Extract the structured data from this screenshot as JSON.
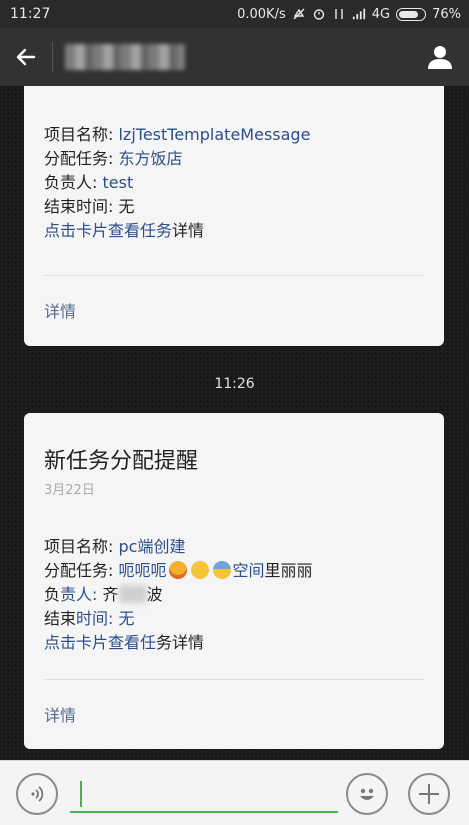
{
  "status_bar": {
    "time": "11:27",
    "network_speed": "0.00K/s",
    "network_type": "4G",
    "battery": "76%"
  },
  "header": {
    "back_icon": "arrow-left-icon",
    "profile_icon": "person-icon"
  },
  "messages": [
    {
      "rows": [
        {
          "label": "项目名称: ",
          "value": "lzjTestTemplateMessage"
        },
        {
          "label": "分配任务: ",
          "value": "东方饭店"
        },
        {
          "label": "负责人: ",
          "value": "test"
        },
        {
          "label": "结束时间: ",
          "value": "无"
        }
      ],
      "link_text": "点击卡片查看任务",
      "link_suffix": "详情",
      "detail": "详情"
    },
    {
      "time": "11:26",
      "title": "新任务分配提醒",
      "date": "3月22日",
      "rows": [
        {
          "label": "项目名称: ",
          "value": "pc端创建"
        },
        {
          "label": "分配任务: ",
          "value": "呃呃呃",
          "value_tail_link": "空间",
          "value_tail": "里丽丽"
        },
        {
          "label": "负",
          "value": "责人: ",
          "tail_pre": "齐",
          "tail": "波"
        },
        {
          "label": "结束",
          "value": "时间: 无"
        }
      ],
      "link_text": "点击卡片查看任",
      "link_suffix": "务详情",
      "detail": "详情"
    }
  ],
  "input_bar": {
    "placeholder": "",
    "voice_icon": "voice-icon",
    "emoji_icon": "emoji-icon",
    "plus_icon": "plus-icon"
  },
  "colors": {
    "link": "#2b4f8a",
    "accent": "#4caf50"
  }
}
